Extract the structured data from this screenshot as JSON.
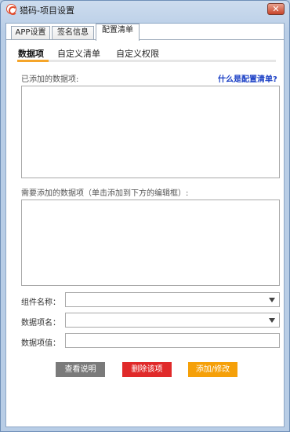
{
  "window": {
    "title": "猎码-项目设置",
    "close_label": "✕"
  },
  "tabs": [
    {
      "label": "APP设置"
    },
    {
      "label": "签名信息"
    },
    {
      "label": "配置清单"
    }
  ],
  "subtabs": [
    {
      "label": "数据项"
    },
    {
      "label": "自定义清单"
    },
    {
      "label": "自定义权限"
    }
  ],
  "added_section": {
    "label": "已添加的数据项:",
    "help_link": "什么是配置清单?"
  },
  "needed_section": {
    "label": "需要添加的数据项（单击添加到下方的编辑框）:"
  },
  "form": {
    "component_name_label": "组件名称：",
    "data_item_name_label": "数据项名：",
    "data_item_value_label": "数据项值："
  },
  "buttons": {
    "view_help": "查看说明",
    "delete_item": "删除该项",
    "add_modify": "添加/修改"
  },
  "colors": {
    "accent_orange": "#f5a52a",
    "link_blue": "#1a3fc5",
    "delete_red": "#e02a2a",
    "help_grey": "#7a7a7a",
    "add_orange": "#f5a009"
  }
}
